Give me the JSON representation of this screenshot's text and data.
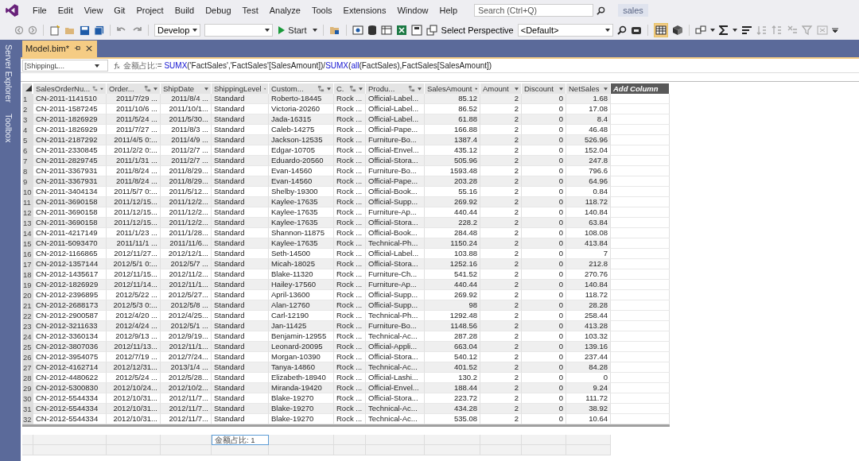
{
  "menu": [
    "File",
    "Edit",
    "View",
    "Git",
    "Project",
    "Build",
    "Debug",
    "Test",
    "Analyze",
    "Tools",
    "Extensions",
    "Window",
    "Help"
  ],
  "search": {
    "placeholder": "Search (Ctrl+Q)"
  },
  "solution_name": "sales",
  "toolbar": {
    "configuration": "Develop",
    "start_label": "Start",
    "perspective_label": "Select Perspective",
    "perspective": "<Default>"
  },
  "side_panels": [
    "Server Explorer",
    "Toolbox"
  ],
  "tabs": [
    {
      "label": "Model.bim*",
      "selected": true
    }
  ],
  "formula_bar": {
    "column": "[ShippingL...",
    "segments": [
      {
        "kind": "name",
        "text": "金额占比:= "
      },
      {
        "kind": "function",
        "text": "SUMX"
      },
      {
        "kind": "plain",
        "text": "('FactSales','FactSales'[SalesAmount])/"
      },
      {
        "kind": "function",
        "text": "SUMX"
      },
      {
        "kind": "plain",
        "text": "("
      },
      {
        "kind": "function",
        "text": "all"
      },
      {
        "kind": "plain",
        "text": "(FactSales),FactSales[SalesAmount])"
      }
    ]
  },
  "table": {
    "columns": [
      {
        "label": "SalesOrderNu...",
        "linked": true
      },
      {
        "label": "Order...",
        "linked": true
      },
      {
        "label": "ShipDate",
        "linked": false
      },
      {
        "label": "ShippingLevel",
        "linked": false,
        "measure": "金额占比: 1"
      },
      {
        "label": "Custom...",
        "linked": true
      },
      {
        "label": "C.",
        "linked": true
      },
      {
        "label": "Produ...",
        "linked": true
      },
      {
        "label": "SalesAmount",
        "linked": false
      },
      {
        "label": "Amount",
        "linked": false
      },
      {
        "label": "Discount",
        "linked": false
      },
      {
        "label": "NetSales",
        "linked": false
      }
    ],
    "add_column": "Add Column",
    "rows": [
      {
        "number": "1",
        "cells": [
          "CN-2011-1141510",
          "2011/7/29 ...",
          "2011/8/4 ...",
          "Standard",
          "Roberto-18445",
          "Rock ...",
          "Official-Label...",
          "85.12",
          "2",
          "0",
          "1.68"
        ]
      },
      {
        "number": "2",
        "cells": [
          "CN-2011-1587245",
          "2011/10/6 ...",
          "2011/10/1...",
          "Standard",
          "Victoria-20260",
          "Rock ...",
          "Official-Label...",
          "86.52",
          "2",
          "0",
          "17.08"
        ]
      },
      {
        "number": "3",
        "cells": [
          "CN-2011-1826929",
          "2011/5/24 ...",
          "2011/5/30...",
          "Standard",
          "Jada-16315",
          "Rock ...",
          "Official-Label...",
          "61.88",
          "2",
          "0",
          "8.4"
        ]
      },
      {
        "number": "4",
        "cells": [
          "CN-2011-1826929",
          "2011/7/27 ...",
          "2011/8/3 ...",
          "Standard",
          "Caleb-14275",
          "Rock ...",
          "Official-Pape...",
          "166.88",
          "2",
          "0",
          "46.48"
        ]
      },
      {
        "number": "5",
        "cells": [
          "CN-2011-2187292",
          "2011/4/5 0:...",
          "2011/4/9 ...",
          "Standard",
          "Jackson-12535",
          "Rock ...",
          "Furniture-Bo...",
          "1387.4",
          "2",
          "0",
          "526.96"
        ]
      },
      {
        "number": "6",
        "cells": [
          "CN-2011-2330845",
          "2011/2/2 0:...",
          "2011/2/7 ...",
          "Standard",
          "Edgar-10705",
          "Rock ...",
          "Official-Envel...",
          "435.12",
          "2",
          "0",
          "152.04"
        ]
      },
      {
        "number": "7",
        "cells": [
          "CN-2011-2829745",
          "2011/1/31 ...",
          "2011/2/7 ...",
          "Standard",
          "Eduardo-20560",
          "Rock ...",
          "Official-Stora...",
          "505.96",
          "2",
          "0",
          "247.8"
        ]
      },
      {
        "number": "8",
        "cells": [
          "CN-2011-3367931",
          "2011/8/24 ...",
          "2011/8/29...",
          "Standard",
          "Evan-14560",
          "Rock ...",
          "Furniture-Bo...",
          "1593.48",
          "2",
          "0",
          "796.6"
        ]
      },
      {
        "number": "9",
        "cells": [
          "CN-2011-3367931",
          "2011/8/24 ...",
          "2011/8/29...",
          "Standard",
          "Evan-14560",
          "Rock ...",
          "Official-Pape...",
          "203.28",
          "2",
          "0",
          "64.96"
        ]
      },
      {
        "number": "10",
        "cells": [
          "CN-2011-3404134",
          "2011/5/7 0:...",
          "2011/5/12...",
          "Standard",
          "Shelby-19300",
          "Rock ...",
          "Official-Book...",
          "55.16",
          "2",
          "0",
          "0.84"
        ]
      },
      {
        "number": "11",
        "cells": [
          "CN-2011-3690158",
          "2011/12/15...",
          "2011/12/2...",
          "Standard",
          "Kaylee-17635",
          "Rock ...",
          "Official-Supp...",
          "269.92",
          "2",
          "0",
          "118.72"
        ]
      },
      {
        "number": "12",
        "cells": [
          "CN-2011-3690158",
          "2011/12/15...",
          "2011/12/2...",
          "Standard",
          "Kaylee-17635",
          "Rock ...",
          "Furniture-Ap...",
          "440.44",
          "2",
          "0",
          "140.84"
        ]
      },
      {
        "number": "13",
        "cells": [
          "CN-2011-3690158",
          "2011/12/15...",
          "2011/12/2...",
          "Standard",
          "Kaylee-17635",
          "Rock ...",
          "Official-Stora...",
          "228.2",
          "2",
          "0",
          "63.84"
        ]
      },
      {
        "number": "14",
        "cells": [
          "CN-2011-4217149",
          "2011/1/23 ...",
          "2011/1/28...",
          "Standard",
          "Shannon-11875",
          "Rock ...",
          "Official-Book...",
          "284.48",
          "2",
          "0",
          "108.08"
        ]
      },
      {
        "number": "15",
        "cells": [
          "CN-2011-5093470",
          "2011/11/1 ...",
          "2011/11/6...",
          "Standard",
          "Kaylee-17635",
          "Rock ...",
          "Technical-Ph...",
          "1150.24",
          "2",
          "0",
          "413.84"
        ]
      },
      {
        "number": "16",
        "cells": [
          "CN-2012-1166865",
          "2012/11/27...",
          "2012/12/1...",
          "Standard",
          "Seth-14500",
          "Rock ...",
          "Official-Label...",
          "103.88",
          "2",
          "0",
          "7"
        ]
      },
      {
        "number": "17",
        "cells": [
          "CN-2012-1357144",
          "2012/5/1 0:...",
          "2012/5/7 ...",
          "Standard",
          "Micah-18025",
          "Rock ...",
          "Official-Stora...",
          "1252.16",
          "2",
          "0",
          "212.8"
        ]
      },
      {
        "number": "18",
        "cells": [
          "CN-2012-1435617",
          "2012/11/15...",
          "2012/11/2...",
          "Standard",
          "Blake-11320",
          "Rock ...",
          "Furniture-Ch...",
          "541.52",
          "2",
          "0",
          "270.76"
        ]
      },
      {
        "number": "19",
        "cells": [
          "CN-2012-1826929",
          "2012/11/14...",
          "2012/11/1...",
          "Standard",
          "Hailey-17560",
          "Rock ...",
          "Furniture-Ap...",
          "440.44",
          "2",
          "0",
          "140.84"
        ]
      },
      {
        "number": "20",
        "cells": [
          "CN-2012-2396895",
          "2012/5/22 ...",
          "2012/5/27...",
          "Standard",
          "April-13600",
          "Rock ...",
          "Official-Supp...",
          "269.92",
          "2",
          "0",
          "118.72"
        ]
      },
      {
        "number": "21",
        "cells": [
          "CN-2012-2688173",
          "2012/5/3 0:...",
          "2012/5/8 ...",
          "Standard",
          "Alan-12760",
          "Rock ...",
          "Official-Supp...",
          "98",
          "2",
          "0",
          "28.28"
        ]
      },
      {
        "number": "22",
        "cells": [
          "CN-2012-2900587",
          "2012/4/20 ...",
          "2012/4/25...",
          "Standard",
          "Carl-12190",
          "Rock ...",
          "Technical-Ph...",
          "1292.48",
          "2",
          "0",
          "258.44"
        ]
      },
      {
        "number": "23",
        "cells": [
          "CN-2012-3211633",
          "2012/4/24 ...",
          "2012/5/1 ...",
          "Standard",
          "Jan-11425",
          "Rock ...",
          "Furniture-Bo...",
          "1148.56",
          "2",
          "0",
          "413.28"
        ]
      },
      {
        "number": "24",
        "cells": [
          "CN-2012-3360134",
          "2012/9/13 ...",
          "2012/9/19...",
          "Standard",
          "Benjamin-12955",
          "Rock ...",
          "Technical-Ac...",
          "287.28",
          "2",
          "0",
          "103.32"
        ]
      },
      {
        "number": "25",
        "cells": [
          "CN-2012-3807036",
          "2012/11/13...",
          "2012/11/1...",
          "Standard",
          "Leonard-20095",
          "Rock ...",
          "Official-Appli...",
          "663.04",
          "2",
          "0",
          "139.16"
        ]
      },
      {
        "number": "26",
        "cells": [
          "CN-2012-3954075",
          "2012/7/19 ...",
          "2012/7/24...",
          "Standard",
          "Morgan-10390",
          "Rock ...",
          "Official-Stora...",
          "540.12",
          "2",
          "0",
          "237.44"
        ]
      },
      {
        "number": "27",
        "cells": [
          "CN-2012-4162714",
          "2012/12/31...",
          "2013/1/4 ...",
          "Standard",
          "Tanya-14860",
          "Rock ...",
          "Technical-Ac...",
          "401.52",
          "2",
          "0",
          "84.28"
        ]
      },
      {
        "number": "28",
        "cells": [
          "CN-2012-4480622",
          "2012/5/24 ...",
          "2012/5/28...",
          "Standard",
          "Elizabeth-18940",
          "Rock ...",
          "Official-Lashi...",
          "130.2",
          "2",
          "0",
          "0"
        ]
      },
      {
        "number": "29",
        "cells": [
          "CN-2012-5300830",
          "2012/10/24...",
          "2012/10/2...",
          "Standard",
          "Miranda-19420",
          "Rock ...",
          "Official-Envel...",
          "188.44",
          "2",
          "0",
          "9.24"
        ]
      },
      {
        "number": "30",
        "cells": [
          "CN-2012-5544334",
          "2012/10/31...",
          "2012/11/7...",
          "Standard",
          "Blake-19270",
          "Rock ...",
          "Official-Stora...",
          "223.72",
          "2",
          "0",
          "111.72"
        ]
      },
      {
        "number": "31",
        "cells": [
          "CN-2012-5544334",
          "2012/10/31...",
          "2012/11/7...",
          "Standard",
          "Blake-19270",
          "Rock ...",
          "Technical-Ac...",
          "434.28",
          "2",
          "0",
          "38.92"
        ]
      },
      {
        "number": "32",
        "cells": [
          "CN-2012-5544334",
          "2012/10/31...",
          "2012/11/7...",
          "Standard",
          "Blake-19270",
          "Rock ...",
          "Technical-Ac...",
          "535.08",
          "2",
          "0",
          "10.64"
        ]
      }
    ]
  }
}
